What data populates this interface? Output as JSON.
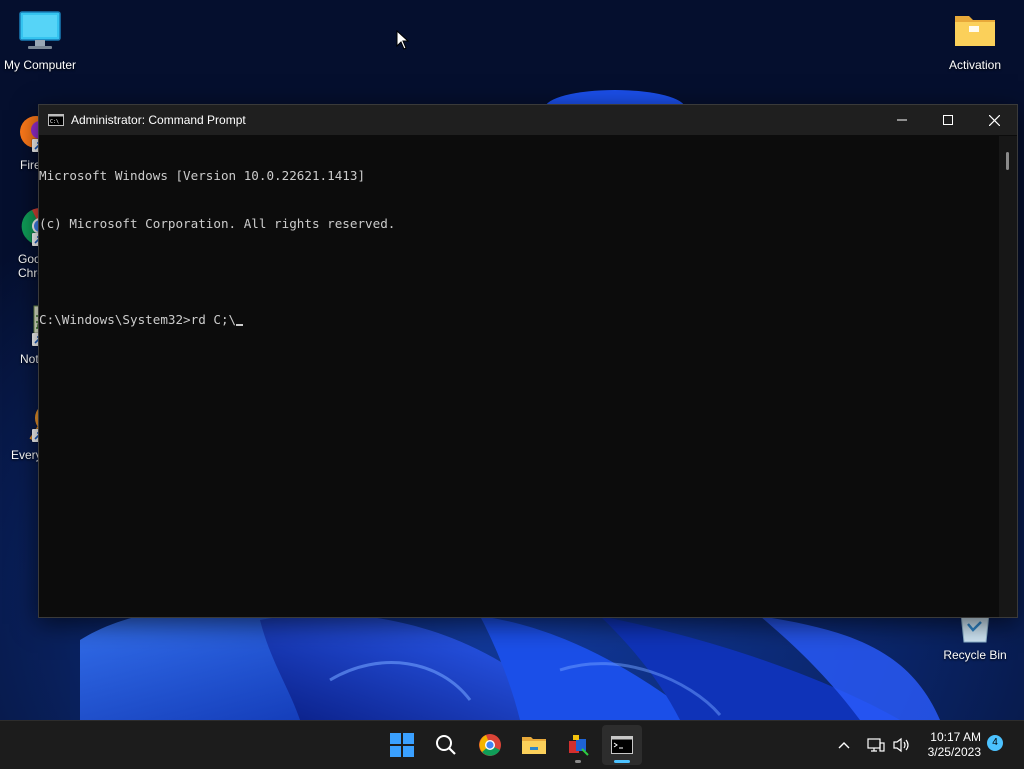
{
  "desktop": {
    "icons": [
      {
        "label": "My Computer"
      },
      {
        "label": "Fire"
      },
      {
        "label": "Goo\nChro"
      },
      {
        "label": "Notep"
      },
      {
        "label": "Every"
      },
      {
        "label": "Activation"
      },
      {
        "label": "Recycle Bin"
      }
    ]
  },
  "cmd_window": {
    "title": "Administrator: Command Prompt",
    "lines": [
      "Microsoft Windows [Version 10.0.22621.1413]",
      "(c) Microsoft Corporation. All rights reserved.",
      "",
      "C:\\Windows\\System32>rd C;\\"
    ]
  },
  "taskbar": {
    "items": [
      "start-icon",
      "search-icon",
      "chrome-icon",
      "file-explorer-icon",
      "app-icon",
      "command-prompt-icon"
    ],
    "clock": {
      "time": "10:17 AM",
      "date": "3/25/2023"
    },
    "notification_count": "4"
  }
}
